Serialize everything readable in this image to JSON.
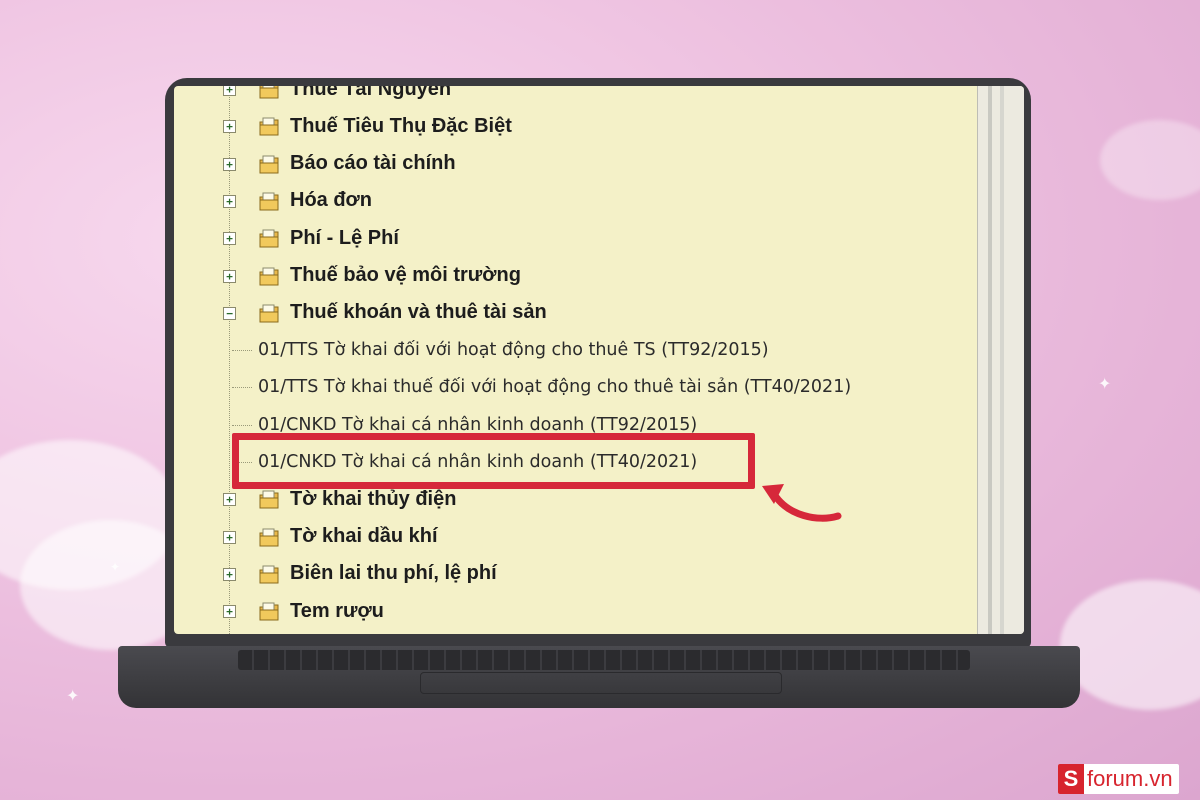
{
  "tree": {
    "items": [
      {
        "kind": "folder",
        "label": "Thuế Tài Nguyên",
        "expanded": false
      },
      {
        "kind": "folder",
        "label": "Thuế Tiêu Thụ Đặc Biệt",
        "expanded": false
      },
      {
        "kind": "folder",
        "label": "Báo cáo tài chính",
        "expanded": false
      },
      {
        "kind": "folder",
        "label": "Hóa đơn",
        "expanded": false
      },
      {
        "kind": "folder",
        "label": "Phí - Lệ Phí",
        "expanded": false
      },
      {
        "kind": "folder",
        "label": "Thuế bảo vệ môi trường",
        "expanded": false
      },
      {
        "kind": "folder",
        "label": "Thuế khoán và thuê tài sản",
        "expanded": true
      },
      {
        "kind": "leaf",
        "label": "01/TTS Tờ khai đối với hoạt động cho thuê TS (TT92/2015)"
      },
      {
        "kind": "leaf",
        "label": "01/TTS Tờ khai thuế đối với hoạt động cho thuê tài sản (TT40/2021)"
      },
      {
        "kind": "leaf",
        "label": "01/CNKD Tờ khai cá nhân kinh doanh (TT92/2015)"
      },
      {
        "kind": "leaf",
        "label": "01/CNKD Tờ khai cá nhân kinh doanh (TT40/2021)",
        "highlighted": true
      },
      {
        "kind": "folder",
        "label": "Tờ khai thủy điện",
        "expanded": false
      },
      {
        "kind": "folder",
        "label": "Tờ khai dầu khí",
        "expanded": false
      },
      {
        "kind": "folder",
        "label": "Biên lai thu phí, lệ phí",
        "expanded": false
      },
      {
        "kind": "folder",
        "label": "Tem rượu",
        "expanded": false
      }
    ]
  },
  "expander": {
    "collapsed_symbol": "+",
    "expanded_symbol": "−"
  },
  "icons": {
    "folder": "folder-document-icon",
    "annotation": "curved-arrow-icon"
  },
  "colors": {
    "highlight": "#d6283a",
    "screen_bg": "#f4f1c8",
    "brand": "#d7242e"
  },
  "watermark": {
    "letter": "S",
    "text": "forum.vn"
  }
}
